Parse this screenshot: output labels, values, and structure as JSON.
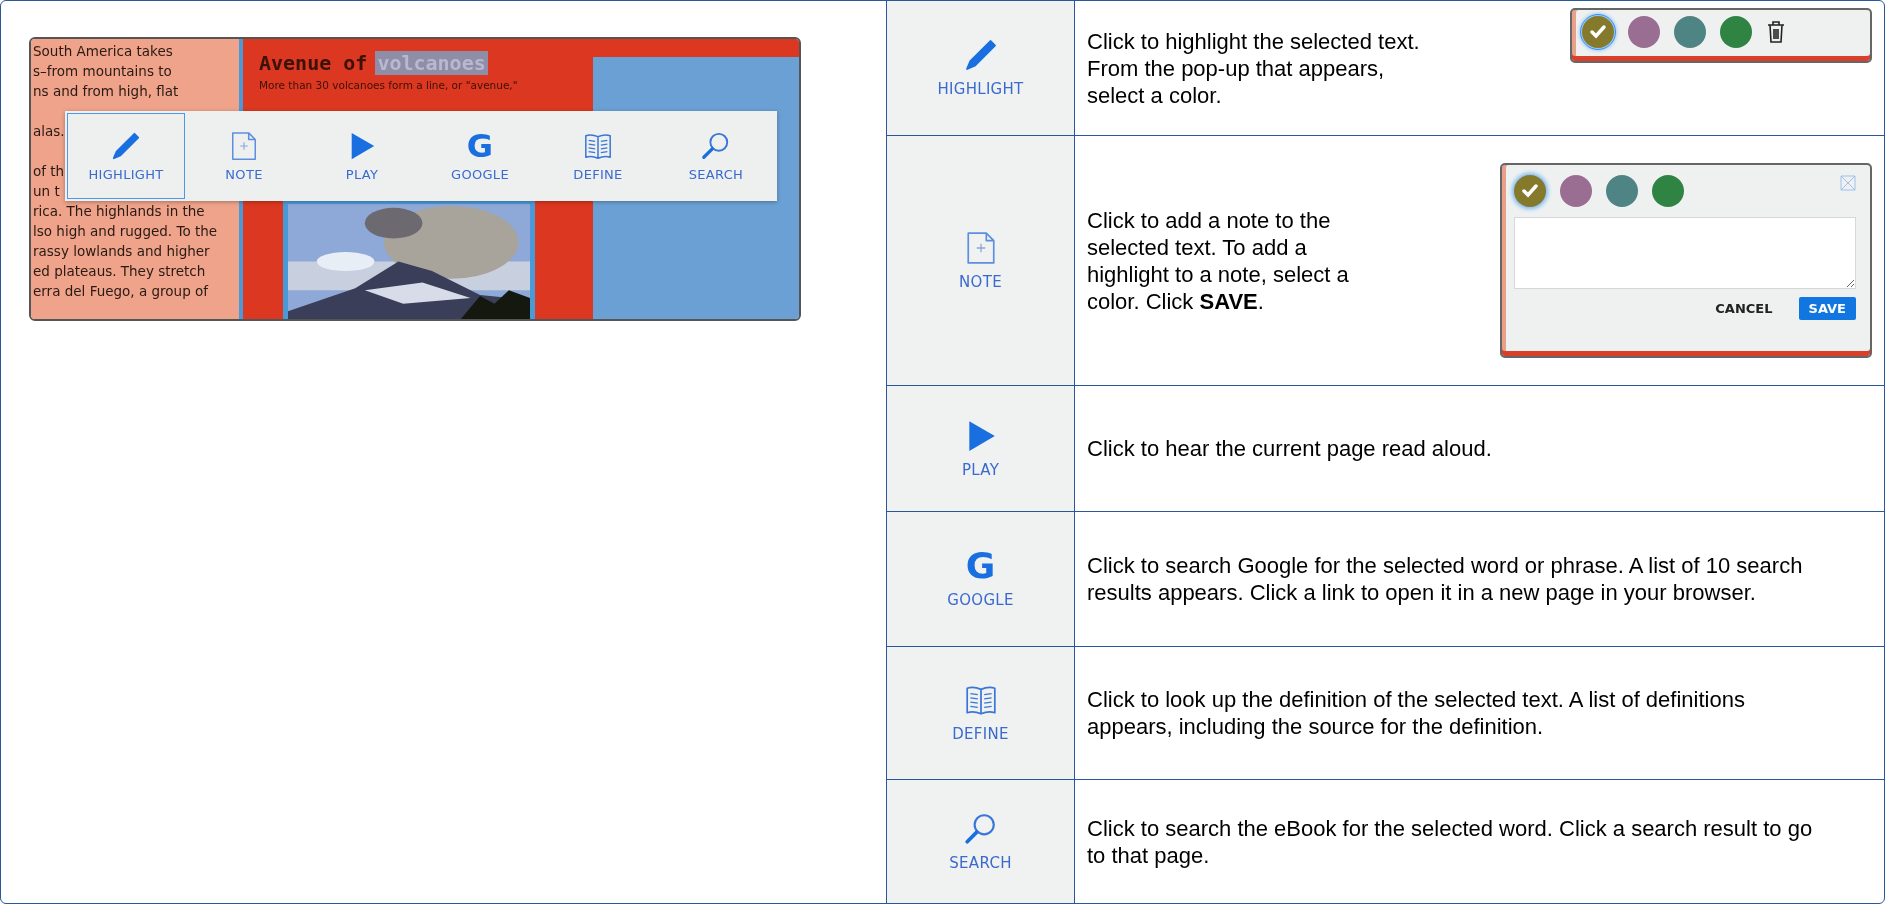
{
  "book_preview": {
    "side_paragraphs": [
      [
        "South America takes",
        "s–from mountains to",
        "ns and from high, flat"
      ],
      [
        "alas."
      ],
      [
        "of th",
        "un t",
        "rica. The highlands in the",
        "lso high and rugged. To the",
        "rassy lowlands and higher",
        "ed plateaus. They stretch",
        "erra del Fuego, a group of"
      ]
    ],
    "heading": "Avenue of",
    "selected_word": "volcanoes",
    "caption": "More than 30 volcanoes form a line, or \"avenue,\"",
    "toolbar": [
      {
        "kind": "highlight",
        "label": "HIGHLIGHT",
        "selected": true
      },
      {
        "kind": "note",
        "label": "NOTE",
        "selected": false
      },
      {
        "kind": "play",
        "label": "PLAY",
        "selected": false
      },
      {
        "kind": "google",
        "label": "GOOGLE",
        "icon_text": "G",
        "selected": false
      },
      {
        "kind": "define",
        "label": "DEFINE",
        "selected": false
      },
      {
        "kind": "search",
        "label": "SEARCH",
        "selected": false
      }
    ]
  },
  "tools": [
    {
      "kind": "highlight",
      "label": "HIGHLIGHT",
      "description": "Click to highlight the selected text. From the pop-up that appears, select a color.",
      "popup": {
        "kind": "highlight",
        "colors": [
          {
            "color": "#857a2c",
            "selected": true
          },
          {
            "color": "#9a6e93",
            "selected": false
          },
          {
            "color": "#4e8584",
            "selected": false
          },
          {
            "color": "#2f8443",
            "selected": false
          }
        ]
      }
    },
    {
      "kind": "note",
      "label": "NOTE",
      "description": "Click to add a note to the selected text. To add a highlight to a note, select a color. Click **SAVE**.",
      "popup": {
        "kind": "note",
        "colors": [
          {
            "color": "#857a2c",
            "selected": true
          },
          {
            "color": "#9a6e93",
            "selected": false
          },
          {
            "color": "#4e8584",
            "selected": false
          },
          {
            "color": "#2f8443",
            "selected": false
          }
        ],
        "buttons": [
          {
            "kind": "cancel",
            "label": "CANCEL"
          },
          {
            "kind": "save",
            "label": "SAVE"
          }
        ]
      }
    },
    {
      "kind": "play",
      "label": "PLAY",
      "description": "Click to hear the current page read aloud."
    },
    {
      "kind": "google",
      "label": "GOOGLE",
      "icon_text": "G",
      "description": "Click to search Google for the selected word or phrase. A list of 10 search results appears. Click a link to open it in a new page in your browser."
    },
    {
      "kind": "define",
      "label": "DEFINE",
      "description": "Click to look up the definition of the selected text. A list of definitions appears, including the source for the definition."
    },
    {
      "kind": "search",
      "label": "SEARCH",
      "description": "Click to search the eBook for the selected word. Click a search result to go to that page."
    }
  ]
}
